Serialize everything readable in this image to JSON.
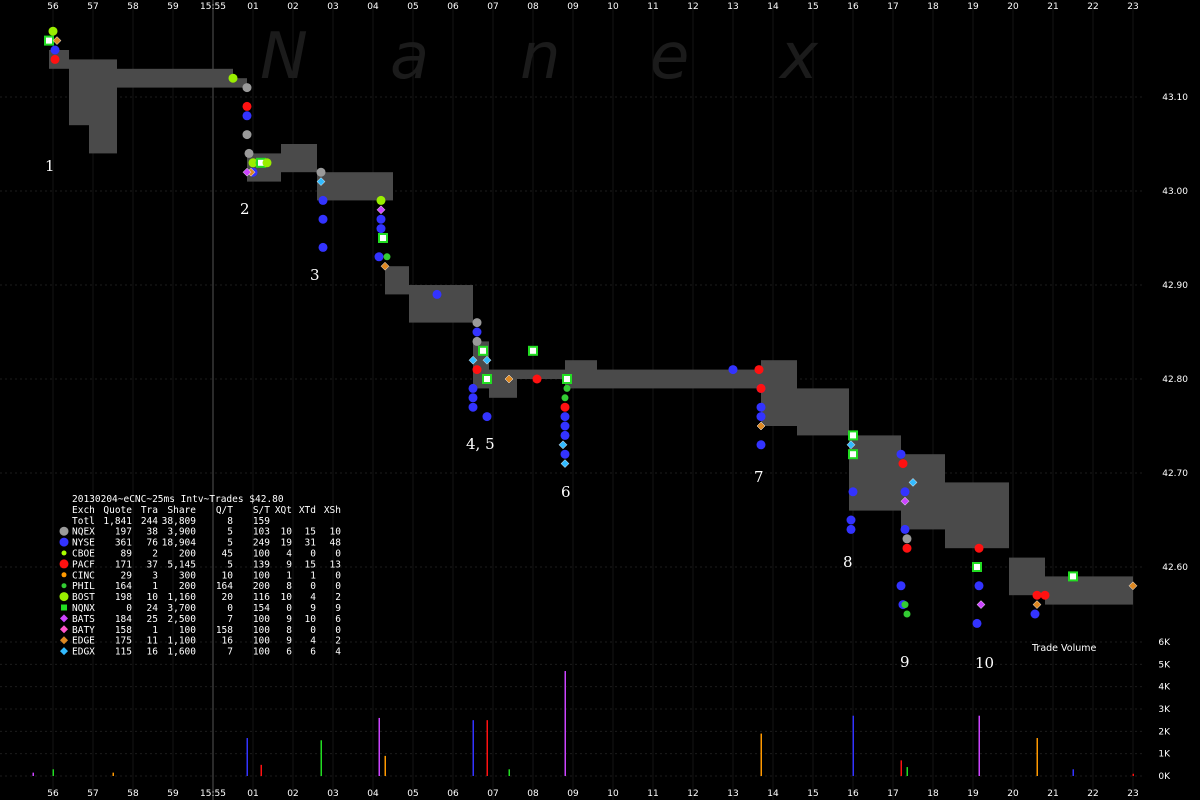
{
  "chart_data": {
    "type": "scatter",
    "title": "20130204~eCNC~25ms Intv~Trades $42.80",
    "watermark": "Nanex",
    "x_ticks": [
      "56",
      "57",
      "58",
      "59",
      "15:55",
      "01",
      "02",
      "03",
      "04",
      "05",
      "06",
      "07",
      "08",
      "09",
      "10",
      "11",
      "12",
      "13",
      "14",
      "15",
      "16",
      "17",
      "18",
      "19",
      "20",
      "21",
      "22",
      "23"
    ],
    "y_price_ticks": [
      "43.10",
      "43.00",
      "42.90",
      "42.80",
      "42.70",
      "42.60"
    ],
    "ylim_price": [
      42.56,
      43.17
    ],
    "y_volume_ticks": [
      "6K",
      "5K",
      "4K",
      "3K",
      "2K",
      "1K",
      "0K"
    ],
    "volume_label": "Trade Volume",
    "annotations": [
      {
        "label": "1",
        "x": 55.9,
        "y": 43.03
      },
      {
        "label": "2",
        "x": 1.8,
        "y": 42.99
      },
      {
        "label": "3",
        "x": 2.9,
        "y": 42.91
      },
      {
        "label": "4, 5",
        "x": 6.8,
        "y": 42.74
      },
      {
        "label": "6",
        "x": 8.9,
        "y": 42.71
      },
      {
        "label": "7",
        "x": 13.65,
        "y": 42.69
      },
      {
        "label": "8",
        "x": 15.9,
        "y": 42.59
      },
      {
        "label": "9",
        "x": 17.3,
        "y": 42.55
      },
      {
        "label": "10",
        "x": 19.2,
        "y": 42.55
      }
    ],
    "legend": {
      "header": [
        "Exch",
        "Quote",
        "Tra",
        "Share",
        "Q/T",
        "S/T",
        "XQt",
        "XTd",
        "XSh"
      ],
      "total": [
        "Totl",
        "1,841",
        "244",
        "38,809",
        "8",
        "159",
        "",
        "",
        ""
      ],
      "rows": [
        {
          "exch": "NQEX",
          "values": [
            "197",
            "38",
            "3,900",
            "5",
            "103",
            "10",
            "15",
            "10"
          ],
          "color": "#9a9a9a",
          "shape": "circle-large"
        },
        {
          "exch": "NYSE",
          "values": [
            "361",
            "76",
            "18,904",
            "5",
            "249",
            "19",
            "31",
            "48"
          ],
          "color": "#3333ff",
          "shape": "circle-large"
        },
        {
          "exch": "CBOE",
          "values": [
            "89",
            "2",
            "200",
            "45",
            "100",
            "4",
            "0",
            "0"
          ],
          "color": "#aaff00",
          "shape": "circle-small"
        },
        {
          "exch": "PACF",
          "values": [
            "171",
            "37",
            "5,145",
            "5",
            "139",
            "9",
            "15",
            "13"
          ],
          "color": "#ff1111",
          "shape": "circle-large"
        },
        {
          "exch": "CINC",
          "values": [
            "29",
            "3",
            "300",
            "10",
            "100",
            "1",
            "1",
            "0"
          ],
          "color": "#ff9900",
          "shape": "circle-small"
        },
        {
          "exch": "PHIL",
          "values": [
            "164",
            "1",
            "200",
            "164",
            "200",
            "8",
            "0",
            "0"
          ],
          "color": "#33cc33",
          "shape": "circle-small"
        },
        {
          "exch": "BOST",
          "values": [
            "198",
            "10",
            "1,160",
            "20",
            "116",
            "10",
            "4",
            "2"
          ],
          "color": "#99ee00",
          "shape": "circle-large"
        },
        {
          "exch": "NQNX",
          "values": [
            "0",
            "24",
            "3,700",
            "0",
            "154",
            "0",
            "9",
            "9"
          ],
          "color": "#22dd22",
          "shape": "square"
        },
        {
          "exch": "BATS",
          "values": [
            "184",
            "25",
            "2,500",
            "7",
            "100",
            "9",
            "10",
            "6"
          ],
          "color": "#cc44ff",
          "shape": "diamond"
        },
        {
          "exch": "BATY",
          "values": [
            "158",
            "1",
            "100",
            "158",
            "100",
            "8",
            "0",
            "0"
          ],
          "color": "#ff55cc",
          "shape": "diamond"
        },
        {
          "exch": "EDGE",
          "values": [
            "175",
            "11",
            "1,100",
            "16",
            "100",
            "9",
            "4",
            "2"
          ],
          "color": "#dd8822",
          "shape": "diamond"
        },
        {
          "exch": "EDGX",
          "values": [
            "115",
            "16",
            "1,600",
            "7",
            "100",
            "6",
            "6",
            "4"
          ],
          "color": "#33bbff",
          "shape": "diamond"
        }
      ]
    },
    "nbbo_band": [
      {
        "x0": 55.9,
        "x1": 56.4,
        "lo": 43.13,
        "hi": 43.15
      },
      {
        "x0": 56.4,
        "x1": 56.9,
        "lo": 43.07,
        "hi": 43.14
      },
      {
        "x0": 56.9,
        "x1": 57.6,
        "lo": 43.04,
        "hi": 43.14
      },
      {
        "x0": 57.6,
        "x1": 58.9,
        "lo": 43.11,
        "hi": 43.13
      },
      {
        "x0": 58.9,
        "x1": 60.5,
        "lo": 43.11,
        "hi": 43.13
      },
      {
        "x0": 60.5,
        "x1": 60.85,
        "lo": 43.11,
        "hi": 43.12
      },
      {
        "x0": 60.85,
        "x1": 61.7,
        "lo": 43.01,
        "hi": 43.04
      },
      {
        "x0": 61.7,
        "x1": 62.6,
        "lo": 43.02,
        "hi": 43.05
      },
      {
        "x0": 62.6,
        "x1": 64.5,
        "lo": 42.99,
        "hi": 43.02
      },
      {
        "x0": 64.3,
        "x1": 64.9,
        "lo": 42.89,
        "hi": 42.92
      },
      {
        "x0": 64.9,
        "x1": 66.5,
        "lo": 42.86,
        "hi": 42.9
      },
      {
        "x0": 66.5,
        "x1": 66.9,
        "lo": 42.79,
        "hi": 42.84
      },
      {
        "x0": 66.9,
        "x1": 67.6,
        "lo": 42.78,
        "hi": 42.81
      },
      {
        "x0": 67.6,
        "x1": 68.8,
        "lo": 42.8,
        "hi": 42.81
      },
      {
        "x0": 68.8,
        "x1": 69.6,
        "lo": 42.79,
        "hi": 42.82
      },
      {
        "x0": 69.6,
        "x1": 73.7,
        "lo": 42.79,
        "hi": 42.81
      },
      {
        "x0": 73.7,
        "x1": 74.6,
        "lo": 42.75,
        "hi": 42.82
      },
      {
        "x0": 74.6,
        "x1": 75.9,
        "lo": 42.74,
        "hi": 42.79
      },
      {
        "x0": 75.9,
        "x1": 77.2,
        "lo": 42.66,
        "hi": 42.74
      },
      {
        "x0": 77.2,
        "x1": 78.3,
        "lo": 42.64,
        "hi": 42.72
      },
      {
        "x0": 78.3,
        "x1": 79.9,
        "lo": 42.62,
        "hi": 42.69
      },
      {
        "x0": 79.9,
        "x1": 80.8,
        "lo": 42.57,
        "hi": 42.61
      },
      {
        "x0": 80.8,
        "x1": 83.0,
        "lo": 42.56,
        "hi": 42.59
      }
    ],
    "trades": [
      {
        "ex": "NQNX",
        "x": 55.9,
        "y": 43.16
      },
      {
        "ex": "BOST",
        "x": 56.0,
        "y": 43.17
      },
      {
        "ex": "EDGE",
        "x": 56.1,
        "y": 43.16
      },
      {
        "ex": "NYSE",
        "x": 56.05,
        "y": 43.15
      },
      {
        "ex": "PACF",
        "x": 56.05,
        "y": 43.14
      },
      {
        "ex": "BOST",
        "x": 60.5,
        "y": 43.12
      },
      {
        "ex": "NQEX",
        "x": 60.85,
        "y": 43.11
      },
      {
        "ex": "PACF",
        "x": 60.85,
        "y": 43.09
      },
      {
        "ex": "NYSE",
        "x": 60.85,
        "y": 43.08
      },
      {
        "ex": "NQEX",
        "x": 60.85,
        "y": 43.06
      },
      {
        "ex": "NQEX",
        "x": 60.9,
        "y": 43.04
      },
      {
        "ex": "BOST",
        "x": 61.0,
        "y": 43.03
      },
      {
        "ex": "NYSE",
        "x": 61.0,
        "y": 43.02
      },
      {
        "ex": "PHIL",
        "x": 61.15,
        "y": 43.03
      },
      {
        "ex": "NQNX",
        "x": 61.2,
        "y": 43.03
      },
      {
        "ex": "BOST",
        "x": 61.35,
        "y": 43.03
      },
      {
        "ex": "EDGE",
        "x": 60.95,
        "y": 43.02
      },
      {
        "ex": "BATS",
        "x": 60.85,
        "y": 43.02
      },
      {
        "ex": "NQEX",
        "x": 62.7,
        "y": 43.02
      },
      {
        "ex": "EDGX",
        "x": 62.7,
        "y": 43.01
      },
      {
        "ex": "NYSE",
        "x": 62.75,
        "y": 42.99
      },
      {
        "ex": "NYSE",
        "x": 62.75,
        "y": 42.97
      },
      {
        "ex": "NYSE",
        "x": 62.75,
        "y": 42.94
      },
      {
        "ex": "BOST",
        "x": 64.2,
        "y": 42.99
      },
      {
        "ex": "BATS",
        "x": 64.2,
        "y": 42.98
      },
      {
        "ex": "NYSE",
        "x": 64.2,
        "y": 42.97
      },
      {
        "ex": "NYSE",
        "x": 64.2,
        "y": 42.96
      },
      {
        "ex": "NQNX",
        "x": 64.25,
        "y": 42.95
      },
      {
        "ex": "NYSE",
        "x": 64.15,
        "y": 42.93
      },
      {
        "ex": "EDGE",
        "x": 64.3,
        "y": 42.92
      },
      {
        "ex": "PHIL",
        "x": 64.35,
        "y": 42.93
      },
      {
        "ex": "NYSE",
        "x": 65.6,
        "y": 42.89
      },
      {
        "ex": "NQEX",
        "x": 66.6,
        "y": 42.86
      },
      {
        "ex": "NYSE",
        "x": 66.6,
        "y": 42.85
      },
      {
        "ex": "NQEX",
        "x": 66.6,
        "y": 42.84
      },
      {
        "ex": "PACF",
        "x": 66.6,
        "y": 42.81
      },
      {
        "ex": "EDGX",
        "x": 66.5,
        "y": 42.82
      },
      {
        "ex": "NQNX",
        "x": 66.75,
        "y": 42.83
      },
      {
        "ex": "NYSE",
        "x": 66.5,
        "y": 42.79
      },
      {
        "ex": "NYSE",
        "x": 66.5,
        "y": 42.78
      },
      {
        "ex": "NYSE",
        "x": 66.5,
        "y": 42.77
      },
      {
        "ex": "NYSE",
        "x": 66.85,
        "y": 42.76
      },
      {
        "ex": "NQNX",
        "x": 66.85,
        "y": 42.8
      },
      {
        "ex": "EDGX",
        "x": 66.85,
        "y": 42.82
      },
      {
        "ex": "EDGE",
        "x": 67.4,
        "y": 42.8
      },
      {
        "ex": "NQNX",
        "x": 68.0,
        "y": 42.83
      },
      {
        "ex": "PACF",
        "x": 68.1,
        "y": 42.8
      },
      {
        "ex": "NQNX",
        "x": 68.85,
        "y": 42.8
      },
      {
        "ex": "PHIL",
        "x": 68.85,
        "y": 42.79
      },
      {
        "ex": "PHIL",
        "x": 68.8,
        "y": 42.78
      },
      {
        "ex": "PACF",
        "x": 68.8,
        "y": 42.77
      },
      {
        "ex": "NYSE",
        "x": 68.8,
        "y": 42.76
      },
      {
        "ex": "NYSE",
        "x": 68.8,
        "y": 42.75
      },
      {
        "ex": "NYSE",
        "x": 68.8,
        "y": 42.74
      },
      {
        "ex": "EDGX",
        "x": 68.75,
        "y": 42.73
      },
      {
        "ex": "NYSE",
        "x": 68.8,
        "y": 42.72
      },
      {
        "ex": "EDGX",
        "x": 68.8,
        "y": 42.71
      },
      {
        "ex": "NYSE",
        "x": 73.0,
        "y": 42.81
      },
      {
        "ex": "PACF",
        "x": 73.65,
        "y": 42.81
      },
      {
        "ex": "NYSE",
        "x": 73.7,
        "y": 42.79
      },
      {
        "ex": "PACF",
        "x": 73.7,
        "y": 42.79
      },
      {
        "ex": "NYSE",
        "x": 73.7,
        "y": 42.77
      },
      {
        "ex": "NYSE",
        "x": 73.7,
        "y": 42.76
      },
      {
        "ex": "EDGE",
        "x": 73.7,
        "y": 42.75
      },
      {
        "ex": "NYSE",
        "x": 73.7,
        "y": 42.73
      },
      {
        "ex": "NQNX",
        "x": 76.0,
        "y": 42.74
      },
      {
        "ex": "NQNX",
        "x": 76.0,
        "y": 42.72
      },
      {
        "ex": "EDGX",
        "x": 75.95,
        "y": 42.73
      },
      {
        "ex": "NYSE",
        "x": 76.0,
        "y": 42.68
      },
      {
        "ex": "NYSE",
        "x": 75.95,
        "y": 42.65
      },
      {
        "ex": "NYSE",
        "x": 75.95,
        "y": 42.64
      },
      {
        "ex": "NYSE",
        "x": 77.2,
        "y": 42.72
      },
      {
        "ex": "PACF",
        "x": 77.25,
        "y": 42.71
      },
      {
        "ex": "NYSE",
        "x": 77.3,
        "y": 42.68
      },
      {
        "ex": "BATS",
        "x": 77.3,
        "y": 42.67
      },
      {
        "ex": "EDGX",
        "x": 77.5,
        "y": 42.69
      },
      {
        "ex": "NYSE",
        "x": 77.3,
        "y": 42.64
      },
      {
        "ex": "NQEX",
        "x": 77.35,
        "y": 42.63
      },
      {
        "ex": "PACF",
        "x": 77.35,
        "y": 42.62
      },
      {
        "ex": "NYSE",
        "x": 77.2,
        "y": 42.58
      },
      {
        "ex": "NYSE",
        "x": 77.25,
        "y": 42.56
      },
      {
        "ex": "PHIL",
        "x": 77.3,
        "y": 42.56
      },
      {
        "ex": "PHIL",
        "x": 77.35,
        "y": 42.55
      },
      {
        "ex": "PACF",
        "x": 79.15,
        "y": 42.62
      },
      {
        "ex": "NQNX",
        "x": 79.1,
        "y": 42.6
      },
      {
        "ex": "NYSE",
        "x": 79.15,
        "y": 42.58
      },
      {
        "ex": "BATS",
        "x": 79.2,
        "y": 42.56
      },
      {
        "ex": "NYSE",
        "x": 79.1,
        "y": 42.54
      },
      {
        "ex": "PACF",
        "x": 80.6,
        "y": 42.57
      },
      {
        "ex": "PACF",
        "x": 80.8,
        "y": 42.57
      },
      {
        "ex": "EDGE",
        "x": 80.6,
        "y": 42.56
      },
      {
        "ex": "NYSE",
        "x": 80.55,
        "y": 42.55
      },
      {
        "ex": "NQNX",
        "x": 81.5,
        "y": 42.59
      },
      {
        "ex": "EDGE",
        "x": 83.0,
        "y": 42.58
      }
    ],
    "volume": [
      {
        "x": 60.85,
        "v": 1700
      },
      {
        "x": 61.2,
        "v": 500
      },
      {
        "x": 62.7,
        "v": 1600
      },
      {
        "x": 64.15,
        "v": 2600
      },
      {
        "x": 64.3,
        "v": 900
      },
      {
        "x": 66.5,
        "v": 2500
      },
      {
        "x": 66.85,
        "v": 2500
      },
      {
        "x": 67.4,
        "v": 300
      },
      {
        "x": 68.8,
        "v": 4700
      },
      {
        "x": 73.7,
        "v": 1900
      },
      {
        "x": 76.0,
        "v": 2700
      },
      {
        "x": 77.2,
        "v": 700
      },
      {
        "x": 77.35,
        "v": 400
      },
      {
        "x": 79.15,
        "v": 2700
      },
      {
        "x": 80.6,
        "v": 1700
      },
      {
        "x": 81.5,
        "v": 300
      },
      {
        "x": 83.0,
        "v": 100
      },
      {
        "x": 56.0,
        "v": 300
      },
      {
        "x": 55.5,
        "v": 150
      },
      {
        "x": 57.5,
        "v": 150
      }
    ],
    "ylim_volume": [
      0,
      6000
    ]
  }
}
